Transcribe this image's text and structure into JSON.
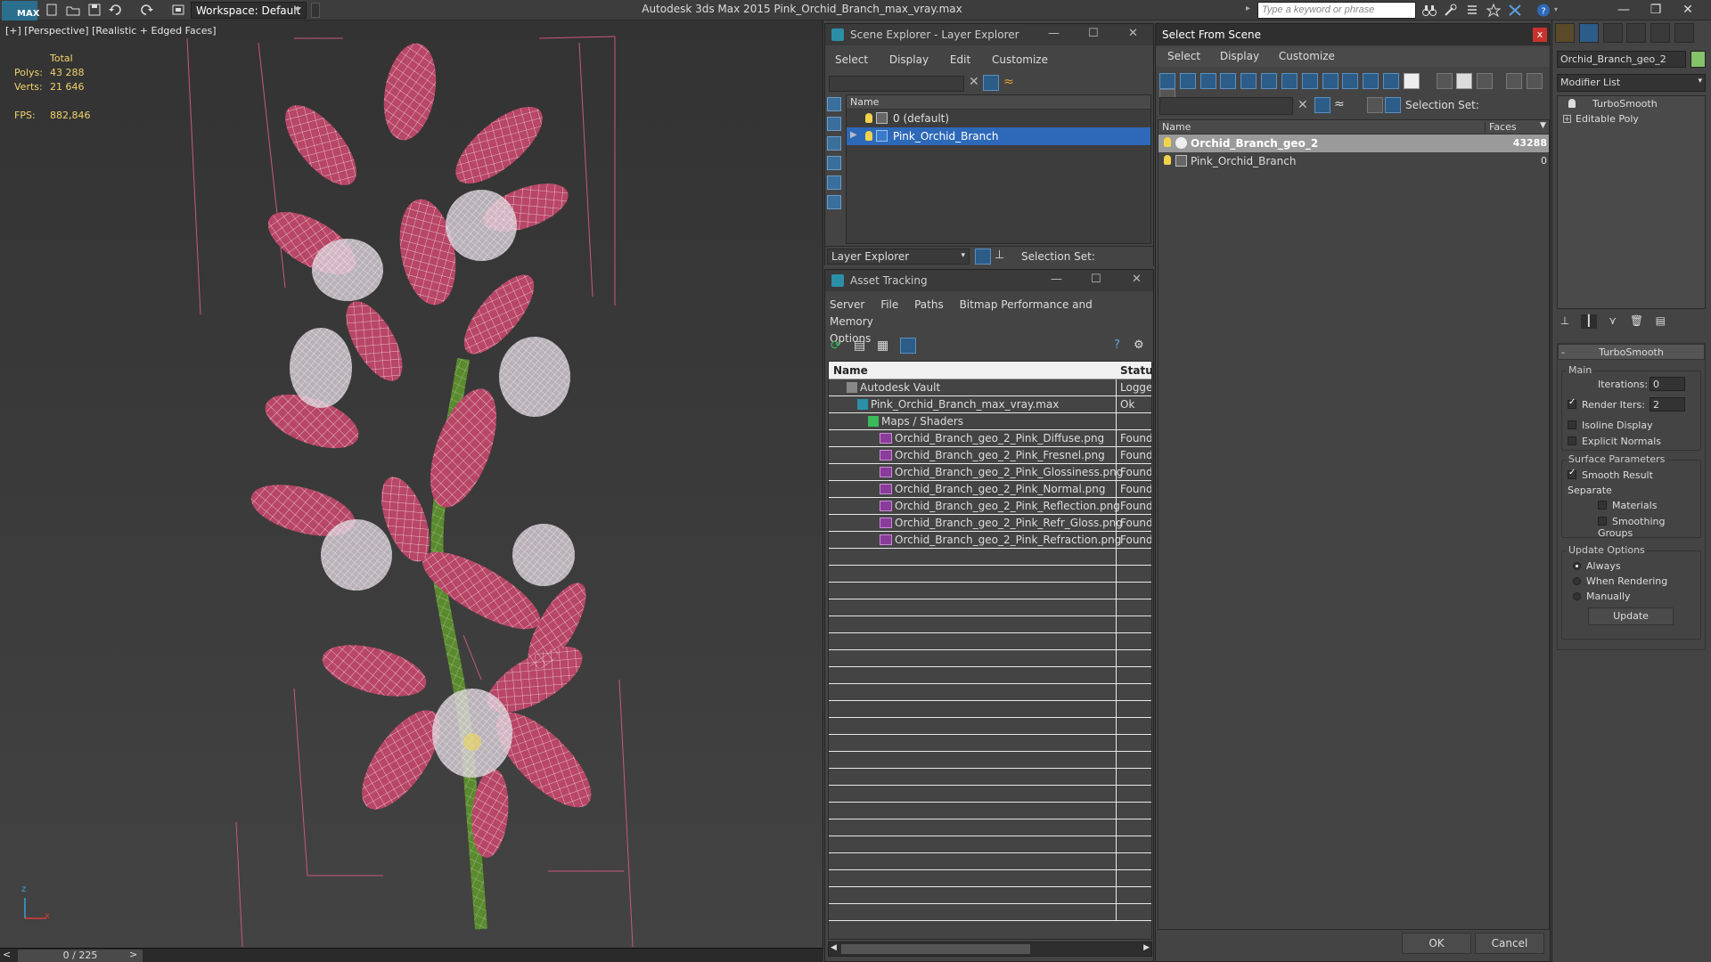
{
  "titlebar": {
    "logo": "MAX",
    "workspace": "Workspace: Default",
    "app_title": "Autodesk 3ds Max  2015     Pink_Orchid_Branch_max_vray.max",
    "search_placeholder": "Type a keyword or phrase",
    "minimize": "—",
    "restore": "❐",
    "close": "✕"
  },
  "viewport": {
    "label": "[+] [Perspective] [Realistic + Edged Faces]",
    "stats": {
      "total_label": "Total",
      "polys_label": "Polys:",
      "polys_value": "43 288",
      "verts_label": "Verts:",
      "verts_value": "21 646",
      "fps_label": "FPS:",
      "fps_value": "882,846"
    },
    "axis_z": "z",
    "axis_x": "x"
  },
  "timebar": {
    "frame": "0 / 225",
    "prev": "<",
    "next": ">"
  },
  "scene_explorer": {
    "title": "Scene Explorer - Layer Explorer",
    "menu": [
      "Select",
      "Display",
      "Edit",
      "Customize"
    ],
    "column_name": "Name",
    "layers": [
      "0 (default)",
      "Pink_Orchid_Branch"
    ],
    "bottom_combo": "Layer Explorer",
    "selection_set_label": "Selection Set:"
  },
  "asset_tracking": {
    "title": "Asset Tracking",
    "menu": [
      "Server",
      "File",
      "Paths",
      "Bitmap Performance and Memory",
      "Options"
    ],
    "col_name": "Name",
    "col_status": "Status",
    "rows": [
      {
        "name": "Autodesk Vault",
        "status": "Logged",
        "level": 1,
        "icon": "vault-icon"
      },
      {
        "name": "Pink_Orchid_Branch_max_vray.max",
        "status": "Ok",
        "level": 2,
        "icon": "max-file-icon"
      },
      {
        "name": "Maps / Shaders",
        "status": "",
        "level": 3,
        "icon": "maps-icon"
      },
      {
        "name": "Orchid_Branch_geo_2_Pink_Diffuse.png",
        "status": "Found",
        "level": 4,
        "icon": "png-icon"
      },
      {
        "name": "Orchid_Branch_geo_2_Pink_Fresnel.png",
        "status": "Found",
        "level": 4,
        "icon": "png-icon"
      },
      {
        "name": "Orchid_Branch_geo_2_Pink_Glossiness.png",
        "status": "Found",
        "level": 4,
        "icon": "png-icon"
      },
      {
        "name": "Orchid_Branch_geo_2_Pink_Normal.png",
        "status": "Found",
        "level": 4,
        "icon": "png-icon"
      },
      {
        "name": "Orchid_Branch_geo_2_Pink_Reflection.png",
        "status": "Found",
        "level": 4,
        "icon": "png-icon"
      },
      {
        "name": "Orchid_Branch_geo_2_Pink_Refr_Gloss.png",
        "status": "Found",
        "level": 4,
        "icon": "png-icon"
      },
      {
        "name": "Orchid_Branch_geo_2_Pink_Refraction.png",
        "status": "Found",
        "level": 4,
        "icon": "png-icon"
      }
    ]
  },
  "select_from_scene": {
    "title": "Select From Scene",
    "close": "x",
    "menu": [
      "Select",
      "Display",
      "Customize"
    ],
    "selection_set_label": "Selection Set:",
    "col_name": "Name",
    "col_faces": "Faces",
    "rows": [
      {
        "name": "Orchid_Branch_geo_2",
        "faces": "43288",
        "selected": true
      },
      {
        "name": "Pink_Orchid_Branch",
        "faces": "0",
        "selected": false
      }
    ],
    "ok": "OK",
    "cancel": "Cancel"
  },
  "command_panel": {
    "object_name": "Orchid_Branch_geo_2",
    "object_color": "#84c36a",
    "modifier_list": "Modifier List",
    "stack": [
      "TurboSmooth",
      "Editable Poly"
    ],
    "turbosmooth": {
      "title": "TurboSmooth",
      "main_label": "Main",
      "iterations_label": "Iterations:",
      "iterations_value": "0",
      "render_iters_label": "Render Iters:",
      "render_iters_value": "2",
      "isoline": "Isoline Display",
      "explicit_normals": "Explicit Normals",
      "surface_params": "Surface Parameters",
      "smooth_result": "Smooth Result",
      "separate": "Separate",
      "materials": "Materials",
      "smoothing_groups": "Smoothing Groups",
      "update_options": "Update Options",
      "always": "Always",
      "when_rendering": "When Rendering",
      "manually": "Manually",
      "update": "Update"
    }
  },
  "colors": {
    "selection_blue": "#2d69b8",
    "petal_pink": "#c04a6a",
    "stem_green": "#5a8a2e",
    "stat_yellow": "#f2d36b"
  }
}
